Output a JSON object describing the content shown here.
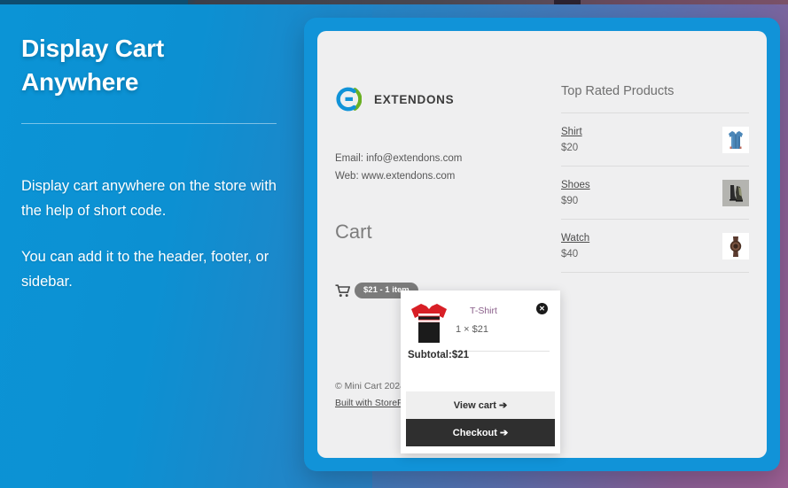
{
  "promo": {
    "title_line1": "Display Cart",
    "title_line2": "Anywhere",
    "paragraph1": "Display cart anywhere on the store with the help of short code.",
    "paragraph2": "You can add it to the header, footer, or sidebar."
  },
  "store": {
    "brand_name": "EXTENDONS",
    "email_line": "Email: info@extendons.com",
    "web_line": "Web: www.extendons.com",
    "cart_heading": "Cart",
    "cart_badge": "$21 -  1 item",
    "footer_copyright": "© Mini Cart 2024",
    "footer_link": "Built with StoreF"
  },
  "top_rated": {
    "title": "Top Rated Products",
    "products": [
      {
        "name": "Shirt",
        "price": "$20",
        "thumb": "shirt-thumb"
      },
      {
        "name": "Shoes",
        "price": "$90",
        "thumb": "shoes-thumb"
      },
      {
        "name": "Watch",
        "price": "$40",
        "thumb": "watch-thumb"
      }
    ]
  },
  "mini_cart": {
    "item_name": "T-Shirt",
    "item_qty_price": "1 × $21",
    "subtotal_label": "Subtotal:$21",
    "view_cart_label": "View cart",
    "checkout_label": "Checkout",
    "arrow": "➔",
    "remove_glyph": "✕"
  },
  "colors": {
    "brand_blue": "#1193d8",
    "brand_green": "#6ab023",
    "panel_gray": "#efeff0",
    "dark_button": "#2f2f2f",
    "badge_gray": "#7b7b7b",
    "item_title_purple": "#8a5f8a"
  }
}
